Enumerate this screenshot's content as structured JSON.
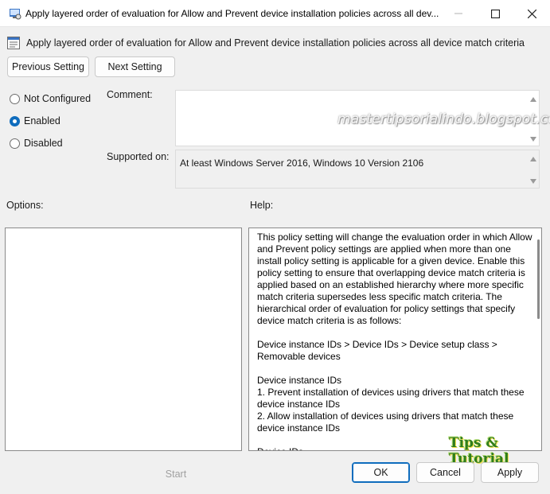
{
  "window": {
    "title": "Apply layered order of evaluation for Allow and Prevent device installation policies across all dev..."
  },
  "policy": {
    "title": "Apply layered order of evaluation for Allow and Prevent device installation policies across all device match criteria"
  },
  "nav": {
    "previous_label": "Previous Setting",
    "next_label": "Next Setting"
  },
  "state": {
    "options": [
      {
        "label": "Not Configured",
        "checked": false
      },
      {
        "label": "Enabled",
        "checked": true
      },
      {
        "label": "Disabled",
        "checked": false
      }
    ]
  },
  "fields": {
    "comment_label": "Comment:",
    "comment_value": "",
    "supported_label": "Supported on:",
    "supported_value": "At least Windows Server 2016, Windows 10 Version 2106"
  },
  "sections": {
    "options_label": "Options:",
    "help_label": "Help:"
  },
  "help": {
    "text": "This policy setting will change the evaluation order in which Allow and Prevent policy settings are applied when more than one install policy setting is applicable for a given device. Enable this policy setting to ensure that overlapping device match criteria is applied based on an established hierarchy where more specific match criteria supersedes less specific match criteria. The hierarchical order of evaluation for policy settings that specify device match criteria is as follows:\n\nDevice instance IDs > Device IDs > Device setup class > Removable devices\n\nDevice instance IDs\n1. Prevent installation of devices using drivers that match these device instance IDs\n2. Allow installation of devices using drivers that match these device instance IDs\n\nDevice IDs"
  },
  "footer": {
    "start_label": "Start",
    "ok_label": "OK",
    "cancel_label": "Cancel",
    "apply_label": "Apply"
  },
  "watermark": {
    "blog_text": "mastertipsorialindo.blogspot.com",
    "logo_text": "Tips & Tutorial"
  },
  "colors": {
    "accent": "#0f6cbd",
    "window_bg": "#f0f0f0"
  }
}
